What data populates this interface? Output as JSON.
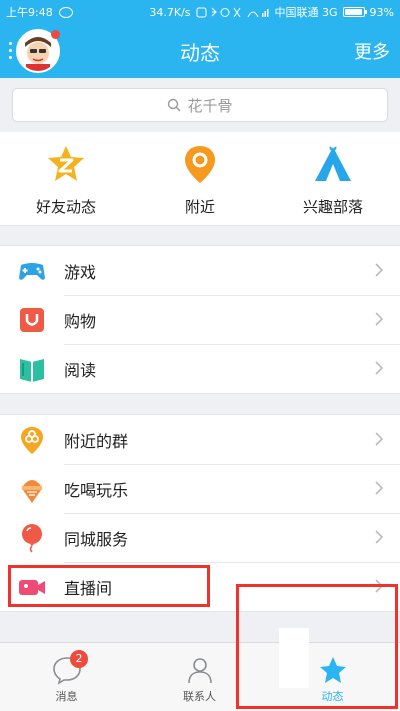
{
  "status_bar": {
    "time": "上午9:48",
    "speed": "34.7K/s",
    "carrier": "中国联通 3G",
    "battery": "93%"
  },
  "header": {
    "title": "动态",
    "more_label": "更多"
  },
  "search": {
    "placeholder": "花千骨"
  },
  "quick_grid": [
    {
      "label": "好友动态",
      "icon": "friend-feed-icon",
      "color": "#f5b21b"
    },
    {
      "label": "附近",
      "icon": "nearby-pin-icon",
      "color": "#f59a1e"
    },
    {
      "label": "兴趣部落",
      "icon": "tribe-tent-icon",
      "color": "#27a7ea"
    }
  ],
  "list_group_1": [
    {
      "label": "游戏",
      "icon": "gamepad-icon",
      "color": "#2ea2e6"
    },
    {
      "label": "购物",
      "icon": "shopping-bag-icon",
      "color": "#ef5a47"
    },
    {
      "label": "阅读",
      "icon": "book-icon",
      "color": "#2dbfa2"
    }
  ],
  "list_group_2": [
    {
      "label": "附近的群",
      "icon": "nearby-group-icon",
      "color": "#f5a623"
    },
    {
      "label": "吃喝玩乐",
      "icon": "ice-cream-icon",
      "color": "#f2893a"
    },
    {
      "label": "同城服务",
      "icon": "balloon-icon",
      "color": "#ef5a47"
    },
    {
      "label": "直播间",
      "icon": "video-camera-icon",
      "color": "#f04b74"
    }
  ],
  "bottom_nav": {
    "tabs": [
      {
        "label": "消息",
        "icon": "message-bubble-icon",
        "badge": "2"
      },
      {
        "label": "联系人",
        "icon": "contacts-person-icon"
      },
      {
        "label": "动态",
        "icon": "star-icon",
        "active": true
      }
    ]
  },
  "colors": {
    "accent": "#2ab5f0",
    "highlight_box": "#f0322c"
  }
}
